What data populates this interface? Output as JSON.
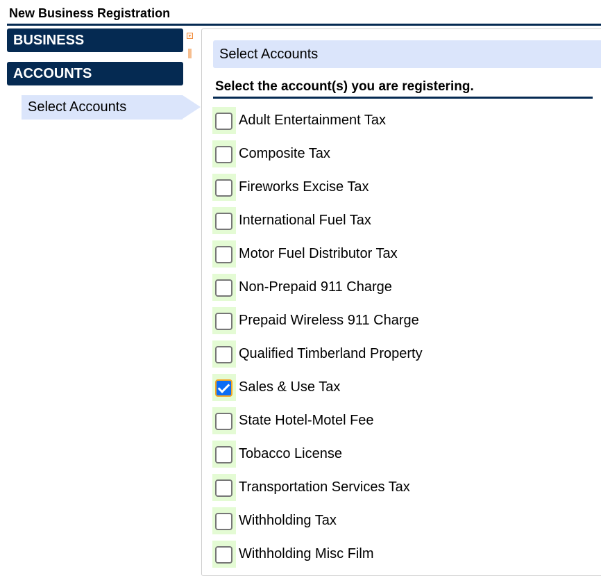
{
  "page": {
    "title": "New Business Registration"
  },
  "sidebar": {
    "sections": [
      {
        "label": "BUSINESS"
      },
      {
        "label": "ACCOUNTS"
      }
    ],
    "active_item": {
      "label": "Select Accounts"
    },
    "expand_icon": "expand-plus-icon",
    "grip_icon": "resize-grip-icon"
  },
  "main": {
    "header": "Select Accounts",
    "instruction": "Select the account(s) you are registering.",
    "accounts": [
      {
        "label": "Adult Entertainment Tax",
        "checked": false
      },
      {
        "label": "Composite Tax",
        "checked": false
      },
      {
        "label": "Fireworks Excise Tax",
        "checked": false
      },
      {
        "label": "International Fuel Tax",
        "checked": false
      },
      {
        "label": "Motor Fuel Distributor Tax",
        "checked": false
      },
      {
        "label": "Non-Prepaid 911 Charge",
        "checked": false
      },
      {
        "label": "Prepaid Wireless 911 Charge",
        "checked": false
      },
      {
        "label": "Qualified Timberland Property",
        "checked": false
      },
      {
        "label": "Sales & Use Tax",
        "checked": true
      },
      {
        "label": "State Hotel-Motel Fee",
        "checked": false
      },
      {
        "label": "Tobacco License",
        "checked": false
      },
      {
        "label": "Transportation Services Tax",
        "checked": false
      },
      {
        "label": "Withholding Tax",
        "checked": false
      },
      {
        "label": "Withholding Misc Film",
        "checked": false
      }
    ]
  },
  "colors": {
    "navy": "#052a52",
    "light_blue": "#dbe5fb",
    "checkbox_highlight": "#e4fbd4",
    "checked_fill": "#0b6cf5",
    "focus_ring": "#f5a623",
    "accent_orange": "#f08c3c"
  }
}
